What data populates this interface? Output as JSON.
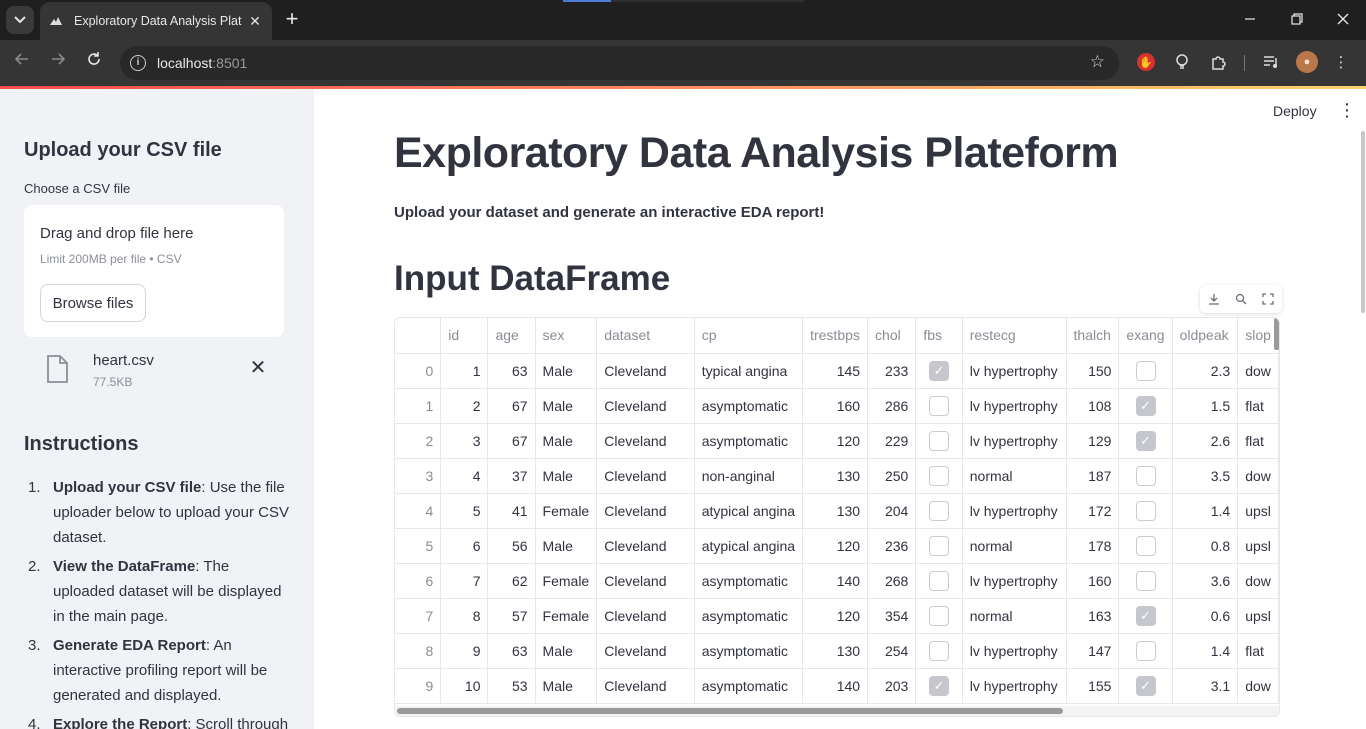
{
  "browser": {
    "tab_title": "Exploratory Data Analysis Platef",
    "url_host": "localhost",
    "url_port": ":8501"
  },
  "header": {
    "deploy_label": "Deploy"
  },
  "sidebar": {
    "heading": "Upload your CSV file",
    "uploader_label": "Choose a CSV file",
    "drop_title": "Drag and drop file here",
    "drop_subtitle": "Limit 200MB per file • CSV",
    "browse_label": "Browse files",
    "file_name": "heart.csv",
    "file_size": "77.5KB",
    "instructions_heading": "Instructions",
    "instructions": [
      {
        "num": "1.",
        "bold": "Upload your CSV file",
        "text": ": Use the file uploader below to upload your CSV dataset."
      },
      {
        "num": "2.",
        "bold": "View the DataFrame",
        "text": ": The uploaded dataset will be displayed in the main page."
      },
      {
        "num": "3.",
        "bold": "Generate EDA Report",
        "text": ": An interactive profiling report will be generated and displayed."
      },
      {
        "num": "4.",
        "bold": "Explore the Report",
        "text": ": Scroll through"
      }
    ]
  },
  "main": {
    "title": "Exploratory Data Analysis Plateform",
    "subtitle": "Upload your dataset and generate an interactive EDA report!",
    "section_heading": "Input DataFrame"
  },
  "table": {
    "columns": [
      "",
      "id",
      "age",
      "sex",
      "dataset",
      "cp",
      "trestbps",
      "chol",
      "fbs",
      "restecg",
      "thalch",
      "exang",
      "oldpeak",
      "slop"
    ],
    "rows": [
      [
        "0",
        "1",
        "63",
        "Male",
        "Cleveland",
        "typical angina",
        "145",
        "233",
        true,
        "lv hypertrophy",
        "150",
        false,
        "2.3",
        "dow"
      ],
      [
        "1",
        "2",
        "67",
        "Male",
        "Cleveland",
        "asymptomatic",
        "160",
        "286",
        false,
        "lv hypertrophy",
        "108",
        true,
        "1.5",
        "flat"
      ],
      [
        "2",
        "3",
        "67",
        "Male",
        "Cleveland",
        "asymptomatic",
        "120",
        "229",
        false,
        "lv hypertrophy",
        "129",
        true,
        "2.6",
        "flat"
      ],
      [
        "3",
        "4",
        "37",
        "Male",
        "Cleveland",
        "non-anginal",
        "130",
        "250",
        false,
        "normal",
        "187",
        false,
        "3.5",
        "dow"
      ],
      [
        "4",
        "5",
        "41",
        "Female",
        "Cleveland",
        "atypical angina",
        "130",
        "204",
        false,
        "lv hypertrophy",
        "172",
        false,
        "1.4",
        "upsl"
      ],
      [
        "5",
        "6",
        "56",
        "Male",
        "Cleveland",
        "atypical angina",
        "120",
        "236",
        false,
        "normal",
        "178",
        false,
        "0.8",
        "upsl"
      ],
      [
        "6",
        "7",
        "62",
        "Female",
        "Cleveland",
        "asymptomatic",
        "140",
        "268",
        false,
        "lv hypertrophy",
        "160",
        false,
        "3.6",
        "dow"
      ],
      [
        "7",
        "8",
        "57",
        "Female",
        "Cleveland",
        "asymptomatic",
        "120",
        "354",
        false,
        "normal",
        "163",
        true,
        "0.6",
        "upsl"
      ],
      [
        "8",
        "9",
        "63",
        "Male",
        "Cleveland",
        "asymptomatic",
        "130",
        "254",
        false,
        "lv hypertrophy",
        "147",
        false,
        "1.4",
        "flat"
      ],
      [
        "9",
        "10",
        "53",
        "Male",
        "Cleveland",
        "asymptomatic",
        "140",
        "203",
        true,
        "lv hypertrophy",
        "155",
        true,
        "3.1",
        "dow"
      ]
    ]
  },
  "colors": {
    "accent": "#ff4b4b",
    "text": "#31333f",
    "sidebar_bg": "#f0f2f6"
  }
}
